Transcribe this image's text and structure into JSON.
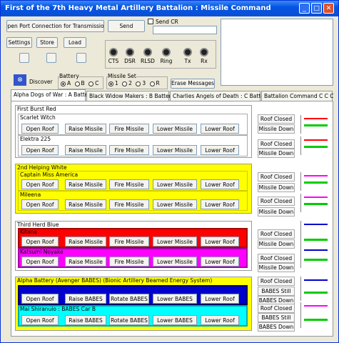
{
  "window": {
    "title": "First of the 7th Heavy Metal Artillery Battalion : Missile Command"
  },
  "top": {
    "open_port": "Open Port Connection for Transmission",
    "send": "Send",
    "send_cr": "Send CR",
    "settings": "Settings",
    "store": "Store",
    "load": "Load",
    "discover": "Discover",
    "erase": "Erase Messages",
    "leds": [
      "CTS",
      "DSR",
      "RLSD",
      "Ring",
      "Tx",
      "Rx"
    ],
    "battery_label": "Battery",
    "battery_options": [
      "A",
      "B",
      "C"
    ],
    "missile_set_label": "Missile Set",
    "missile_set_options": [
      "1",
      "2",
      "3",
      "R"
    ]
  },
  "tabs": [
    "Alpha Dogs of War : A Battery",
    "Black Widow Makers : B Battery",
    "Charlies Angels of Death : C Battery",
    "Battalion Command  C  C  C"
  ],
  "groups": [
    {
      "title": "First Burst Red",
      "units": [
        {
          "name": "Scarlet Witch",
          "buttons": [
            "Open Roof",
            "Raise Missile",
            "Fire Missile",
            "Lower Missile",
            "Lower Roof"
          ],
          "status": [
            "Roof Closed",
            "Missile Down"
          ]
        },
        {
          "name": "Elektra 225",
          "buttons": [
            "Open Roof",
            "Raise Missile",
            "Fire Missile",
            "Lower Missile",
            "Lower Roof"
          ],
          "status": [
            "Roof Closed",
            "Missile Down"
          ]
        }
      ]
    },
    {
      "title": "2nd Helping White",
      "units": [
        {
          "name": "Captain Miss America",
          "buttons": [
            "Open Roof",
            "Raise Missile",
            "Fire Missile",
            "Lower Missile",
            "Lower Roof"
          ],
          "status": [
            "Roof Closed",
            "Missile Down"
          ]
        },
        {
          "name": "Mileena",
          "buttons": [
            "Open Roof",
            "Raise Missile",
            "Fire Missile",
            "Lower Missile",
            "Lower Roof"
          ],
          "status": [
            "Roof Closed",
            "Missile Down"
          ]
        }
      ]
    },
    {
      "title": "Third Herd Blue",
      "units": [
        {
          "name": "Kitana",
          "buttons": [
            "Open Roof",
            "Raise Missile",
            "Fire Missile",
            "Lower Missile",
            "Lower Roof"
          ],
          "status": [
            "Roof Closed",
            "Missile Down"
          ]
        },
        {
          "name": "Katsumi Noyake",
          "buttons": [
            "Open Roof",
            "Raise Missile",
            "Fire Missile",
            "Lower Missile",
            "Lower Roof"
          ],
          "status": [
            "Roof Closed",
            "Missile Down"
          ]
        }
      ]
    },
    {
      "title": "Alpha Battery (Avenger BABES) (Bionic Artillery Beamed Energy System)",
      "units": [
        {
          "name": "",
          "buttons": [
            "Open Roof",
            "Raise BABES",
            "Rotate BABES",
            "Lower BABES",
            "Lower Roof"
          ],
          "status": [
            "Roof Closed",
            "BABES Still",
            "BABES Down"
          ]
        },
        {
          "name": "Mai Shiranuio : BABES Car B",
          "buttons": [
            "Open Roof",
            "Raise BABES",
            "Rotate BABES",
            "Lower BABES",
            "Lower Roof"
          ],
          "status": [
            "Roof Closed",
            "BABES Still",
            "BABES Down"
          ]
        }
      ]
    }
  ],
  "colors": {
    "red": "#ff0000",
    "yellow": "#ffff00",
    "blue": "#0000cc",
    "magenta": "#ff00ff",
    "cyan": "#00ffff",
    "green": "#00cc00"
  }
}
